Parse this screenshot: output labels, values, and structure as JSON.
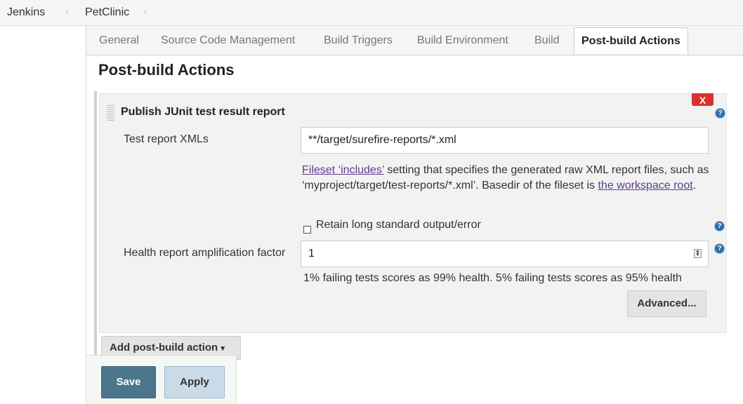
{
  "breadcrumb": {
    "items": [
      "Jenkins",
      "PetClinic"
    ],
    "separator": "›"
  },
  "tabs": [
    {
      "label": "General",
      "active": false
    },
    {
      "label": "Source Code Management",
      "active": false
    },
    {
      "label": "Build Triggers",
      "active": false
    },
    {
      "label": "Build Environment",
      "active": false
    },
    {
      "label": "Build",
      "active": false
    },
    {
      "label": "Post-build Actions",
      "active": true
    }
  ],
  "section": {
    "title": "Post-build Actions"
  },
  "panel": {
    "title": "Publish JUnit test result report",
    "delete_label": "X",
    "test_report_label": "Test report XMLs",
    "test_report_value": "**/target/surefire-reports/*.xml",
    "description": {
      "link1": "Fileset ‘includes’",
      "text1": " setting that specifies the generated raw XML report files, such as ‘myproject/target/test-reports/*.xml’. Basedir of the fileset is ",
      "link2": "the workspace root",
      "text2": "."
    },
    "retain_label": "Retain long standard output/error",
    "retain_checked": false,
    "health_label": "Health report amplification factor",
    "health_value": "1",
    "health_hint": "1% failing tests scores as 99% health. 5% failing tests scores as 95% health",
    "advanced_label": "Advanced..."
  },
  "add_action": {
    "label": "Add post-build action",
    "caret": "▾"
  },
  "footer": {
    "save_label": "Save",
    "apply_label": "Apply"
  },
  "help_icon_glyph": "?",
  "colors": {
    "save_button": "#4b758b",
    "apply_button": "#c9dbe9",
    "delete_button": "#d9322f",
    "link": "#5a3e8c",
    "help_icon": "#2d6fa8"
  }
}
